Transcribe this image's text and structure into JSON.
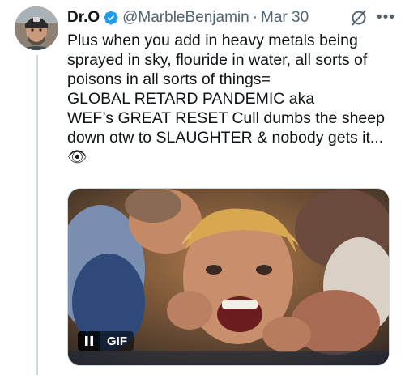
{
  "tweet": {
    "author_name": "Dr.O",
    "handle": "@MarbleBenjamin",
    "separator": "·",
    "date": "Mar 30",
    "text": "Plus when you add in heavy metals being\nsprayed in sky, flouride in water, all sorts of\npoisons in all sorts of things=\nGLOBAL RETARD PANDEMIC aka\nWEF’s GREAT RESET Cull dumbs the sheep\ndown otw to SLAUGHTER & nobody gets it...\n👁",
    "verified_color": "#1d9bf0",
    "icons": [
      "verified-badge-icon",
      "grok-icon",
      "more-icon",
      "pause-icon"
    ],
    "more_label": "•••",
    "media": {
      "type": "gif",
      "badge_label": "GIF"
    }
  }
}
